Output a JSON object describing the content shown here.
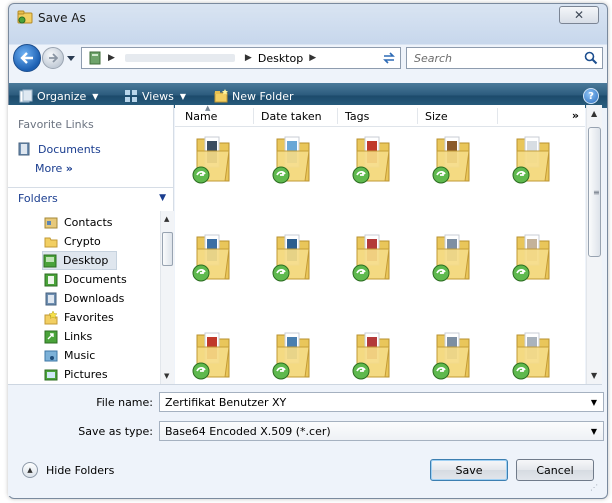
{
  "window": {
    "title": "Save As",
    "close_glyph": "✕"
  },
  "navigation": {
    "back_icon": "back-arrow-icon",
    "forward_icon": "forward-arrow-icon",
    "address_crumb": "Desktop",
    "search_placeholder": "Search"
  },
  "toolbar": {
    "organize_label": "Organize",
    "views_label": "Views",
    "new_folder_label": "New Folder",
    "help_label": "?"
  },
  "sidebar": {
    "favorite_links_heading": "Favorite Links",
    "favorites": [
      {
        "label": "Documents",
        "icon": "documents-icon"
      }
    ],
    "more_label": "More",
    "more_glyph": "»",
    "folders_heading": "Folders",
    "tree": [
      {
        "label": "Contacts",
        "icon": "contacts-icon"
      },
      {
        "label": "Crypto",
        "icon": "folder-icon"
      },
      {
        "label": "Desktop",
        "icon": "desktop-icon",
        "selected": true
      },
      {
        "label": "Documents",
        "icon": "documents-icon"
      },
      {
        "label": "Downloads",
        "icon": "downloads-icon"
      },
      {
        "label": "Favorites",
        "icon": "favorites-icon"
      },
      {
        "label": "Links",
        "icon": "links-icon"
      },
      {
        "label": "Music",
        "icon": "music-icon"
      },
      {
        "label": "Pictures",
        "icon": "pictures-icon"
      }
    ]
  },
  "file_list": {
    "columns": [
      "Name",
      "Date taken",
      "Tags",
      "Size"
    ],
    "more_columns_glyph": "»",
    "item_count": 15
  },
  "footer": {
    "file_name_label": "File name:",
    "file_name_value": "Zertifikat Benutzer XY",
    "save_as_type_label": "Save as type:",
    "save_as_type_value": "Base64 Encoded X.509 (*.cer)",
    "hide_folders_label": "Hide Folders",
    "save_label": "Save",
    "cancel_label": "Cancel"
  },
  "colors": {
    "toolbar_dark": "#1c4a6b",
    "link_blue": "#1a3d8f",
    "folder_yellow": "#f2cf62",
    "shortcut_green": "#4aa33a"
  }
}
